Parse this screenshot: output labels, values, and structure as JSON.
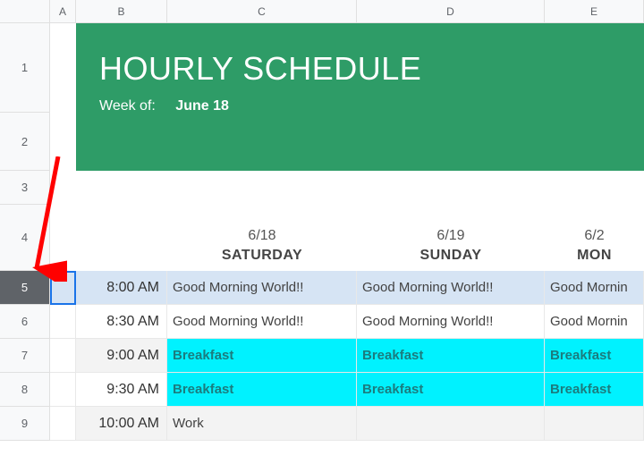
{
  "columns": {
    "A": "A",
    "B": "B",
    "C": "C",
    "D": "D",
    "E": "E"
  },
  "row_labels": [
    "1",
    "2",
    "3",
    "4",
    "5",
    "6",
    "7",
    "8",
    "9"
  ],
  "selected_row_index": 4,
  "banner": {
    "title": "HOURLY SCHEDULE",
    "week_of_label": "Week of:",
    "week_of_value": "June 18"
  },
  "day_headers": [
    {
      "date": "6/18",
      "day": "SATURDAY"
    },
    {
      "date": "6/19",
      "day": "SUNDAY"
    },
    {
      "date": "6/2",
      "day": "MON"
    }
  ],
  "schedule_rows": [
    {
      "time": "8:00 AM",
      "alt": false,
      "cells": [
        "Good Morning World!!",
        "Good Morning World!!",
        "Good Mornin"
      ]
    },
    {
      "time": "8:30 AM",
      "alt": false,
      "cells": [
        "Good Morning World!!",
        "Good Morning World!!",
        "Good Mornin"
      ]
    },
    {
      "time": "9:00 AM",
      "alt": true,
      "cells": [
        "Breakfast",
        "Breakfast",
        "Breakfast"
      ],
      "style": "bf"
    },
    {
      "time": "9:30 AM",
      "alt": false,
      "cells": [
        "Breakfast",
        "Breakfast",
        "Breakfast"
      ],
      "style": "bf"
    },
    {
      "time": "10:00 AM",
      "alt": true,
      "cells": [
        "Work",
        "",
        ""
      ]
    }
  ],
  "annotation": {
    "type": "arrow",
    "color": "#ff0000"
  }
}
